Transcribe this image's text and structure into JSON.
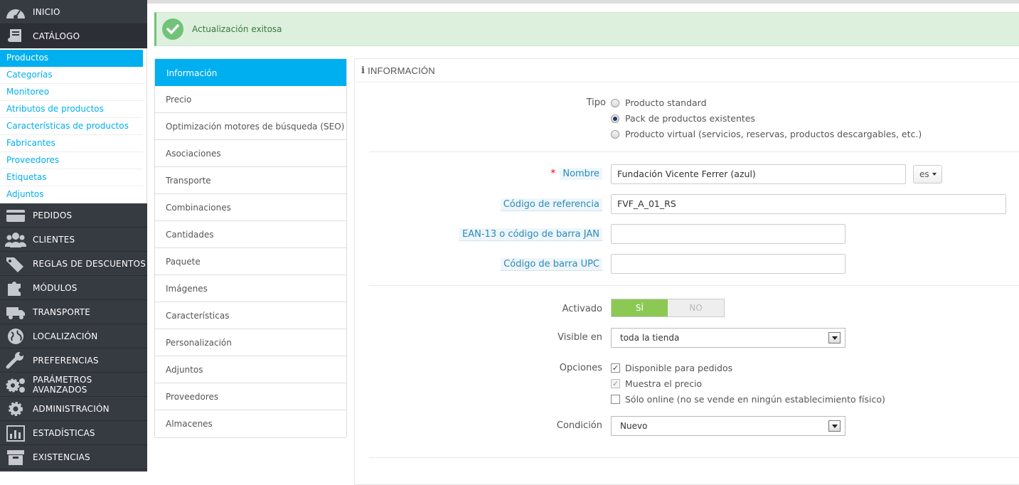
{
  "nav": {
    "items": [
      {
        "label": "INICIO",
        "icon": "dashboard-icon"
      },
      {
        "label": "CATÁLOGO",
        "icon": "book-icon"
      }
    ],
    "submenu": [
      "Productos",
      "Categorías",
      "Monitoreo",
      "Atributos de productos",
      "Características de productos",
      "Fabricantes",
      "Proveedores",
      "Etiquetas",
      "Adjuntos"
    ],
    "items_after": [
      {
        "label": "PEDIDOS",
        "icon": "credit-card-icon"
      },
      {
        "label": "CLIENTES",
        "icon": "users-icon"
      },
      {
        "label": "REGLAS DE DESCUENTOS",
        "icon": "tags-icon"
      },
      {
        "label": "MÓDULOS",
        "icon": "puzzle-icon"
      },
      {
        "label": "TRANSPORTE",
        "icon": "truck-icon"
      },
      {
        "label": "LOCALIZACIÓN",
        "icon": "globe-icon"
      },
      {
        "label": "PREFERENCIAS",
        "icon": "wrench-icon"
      },
      {
        "label": "PARÁMETROS AVANZADOS",
        "icon": "cogs-icon"
      },
      {
        "label": "ADMINISTRACIÓN",
        "icon": "cog-icon"
      },
      {
        "label": "ESTADÍSTICAS",
        "icon": "bar-chart-icon"
      },
      {
        "label": "EXISTENCIAS",
        "icon": "archive-icon"
      }
    ]
  },
  "alert": {
    "message": "Actualización exitosa"
  },
  "tabs": [
    "Información",
    "Precio",
    "Optimización motores de búsqueda (SEO)",
    "Asociaciones",
    "Transporte",
    "Combinaciones",
    "Cantidades",
    "Paquete",
    "Imágenes",
    "Características",
    "Personalización",
    "Adjuntos",
    "Proveedores",
    "Almacenes"
  ],
  "panel": {
    "heading": "INFORMACIÓN",
    "type_label": "Tipo",
    "type_options": [
      "Producto standard",
      "Pack de productos existentes",
      "Producto virtual (servicios, reservas, productos descargables, etc.)"
    ],
    "type_selected": 1,
    "name_label": "Nombre",
    "name_value": "Fundación Vicente Ferrer (azul)",
    "lang": "es",
    "ref_label": "Código de referencia",
    "ref_value": "FVF_A_01_RS",
    "ean_label": "EAN-13 o código de barra JAN",
    "ean_value": "",
    "upc_label": "Código de barra UPC",
    "upc_value": "",
    "active_label": "Activado",
    "yes": "SÍ",
    "no": "NO",
    "visible_label": "Visible en",
    "visible_value": "toda la tienda",
    "options_label": "Opciones",
    "options": [
      {
        "label": "Disponible para pedidos",
        "checked": true
      },
      {
        "label": "Muestra el precio",
        "checked": true,
        "disabled": true
      },
      {
        "label": "Sólo online (no se vende en ningún establecimiento físico)",
        "checked": false
      }
    ],
    "condition_label": "Condición",
    "condition_value": "Nuevo"
  }
}
